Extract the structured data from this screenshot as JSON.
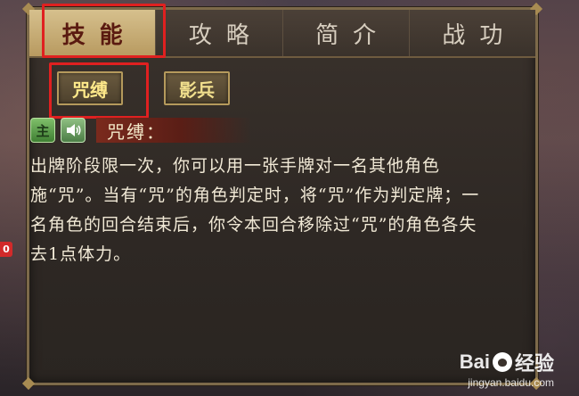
{
  "tabs": [
    {
      "label": "技能",
      "active": true
    },
    {
      "label": "攻略",
      "active": false
    },
    {
      "label": "简介",
      "active": false
    },
    {
      "label": "战功",
      "active": false
    }
  ],
  "skills": [
    {
      "label": "咒缚",
      "active": true
    },
    {
      "label": "影兵",
      "active": false
    }
  ],
  "skill_detail": {
    "type_icon": "主",
    "sound_icon": "speaker-icon",
    "title": "咒缚：",
    "description": "出牌阶段限一次，你可以用一张手牌对一名其他角色施“咒”。当有“咒”的角色判定时，将“咒”作为判定牌；一名角色的回合结束后，你令本回合移除过“咒”的角色各失去1点体力。"
  },
  "side_badge": "0",
  "watermark": {
    "brand_left": "Bai",
    "brand_right": "经验",
    "url": "jingyan.baidu.com"
  },
  "colors": {
    "highlight": "#e02020",
    "active_tab": "#c9ae73",
    "panel": "#2e2824"
  }
}
